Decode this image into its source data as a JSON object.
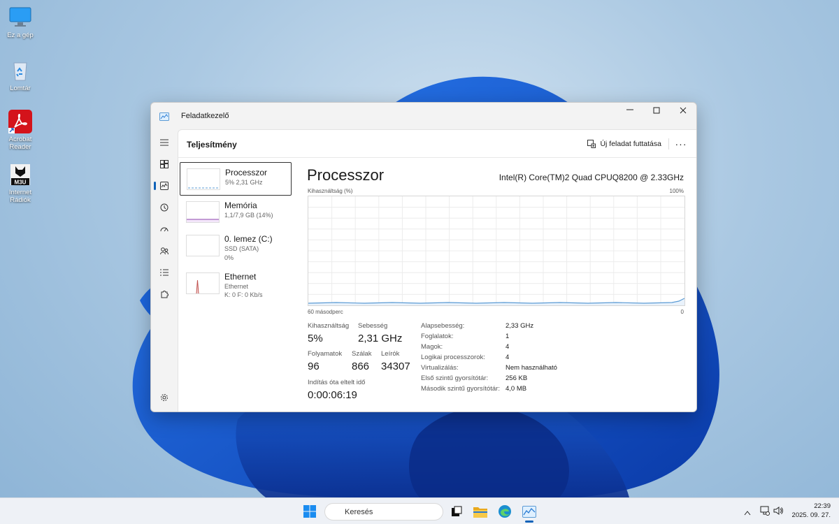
{
  "desktop": {
    "icons": [
      {
        "label": "Ez a gép",
        "icon": "computer-icon"
      },
      {
        "label": "Lomtár",
        "icon": "recycle-bin-icon"
      },
      {
        "label": "Acrobat Reader",
        "icon": "acrobat-reader-icon"
      },
      {
        "label": "Internet Rádiók",
        "icon": "internet-radio-icon",
        "badge": "M3U"
      }
    ]
  },
  "window": {
    "title": "Feladatkezelő",
    "command_bar": {
      "title": "Teljesítmény",
      "run_task_label": "Új feladat futtatása",
      "more_label": "···"
    },
    "devices": [
      {
        "name": "Processzor",
        "sub1": "5% 2,31 GHz",
        "sub2": "",
        "sub3": ""
      },
      {
        "name": "Memória",
        "sub1": "1,1/7,9 GB (14%)",
        "sub2": "",
        "sub3": ""
      },
      {
        "name": "0. lemez (C:)",
        "sub1": "SSD (SATA)",
        "sub2": "0%",
        "sub3": ""
      },
      {
        "name": "Ethernet",
        "sub1": "Ethernet",
        "sub2": "K: 0 F: 0 Kb/s",
        "sub3": ""
      }
    ],
    "main": {
      "title": "Processzor",
      "cpu_model": "Intel(R) Core(TM)2 Quad CPUQ8200 @ 2.33GHz",
      "chart_y_label": "Kihasználtság (%)",
      "chart_y_max": "100%",
      "chart_x_label": "60 másodperc",
      "chart_y_min": "0",
      "stats": {
        "utilization": {
          "label": "Kihasználtság",
          "value": "5%"
        },
        "speed": {
          "label": "Sebesség",
          "value": "2,31 GHz"
        },
        "processes": {
          "label": "Folyamatok",
          "value": "96"
        },
        "threads": {
          "label": "Szálak",
          "value": "866"
        },
        "handles": {
          "label": "Leírók",
          "value": "34307"
        },
        "uptime": {
          "label": "Indítás óta eltelt idő",
          "value": "0:00:06:19"
        }
      },
      "specs": [
        {
          "label": "Alapsebesség:",
          "value": "2,33 GHz"
        },
        {
          "label": "Foglalatok:",
          "value": "1"
        },
        {
          "label": "Magok:",
          "value": "4"
        },
        {
          "label": "Logikai processzorok:",
          "value": "4"
        },
        {
          "label": "Virtualizálás:",
          "value": "Nem használható"
        },
        {
          "label": "Első szintű gyorsítótár:",
          "value": "256 KB"
        },
        {
          "label": "Második szintű gyorsítótár:",
          "value": "4,0 MB"
        }
      ]
    }
  },
  "taskbar": {
    "search_placeholder": "Keresés",
    "time": "22:39",
    "date": "2025. 09. 27."
  },
  "colors": {
    "accent": "#0f62b8",
    "cpu_line": "#5b9bd5",
    "memory_line": "#8e44ad",
    "ethernet_line": "#c0504d"
  }
}
